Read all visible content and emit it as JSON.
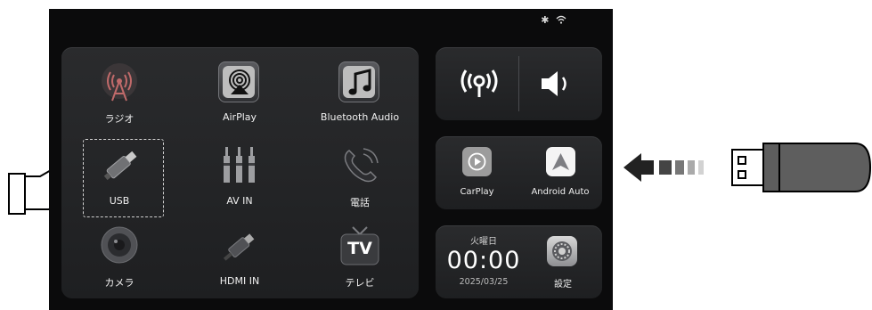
{
  "status": {
    "bluetooth": "bluetooth-icon",
    "wifi": "wifi-icon"
  },
  "apps": [
    {
      "key": "radio",
      "label": "ラジオ",
      "icon": "radio-tower-icon"
    },
    {
      "key": "airplay",
      "label": "AirPlay",
      "icon": "airplay-icon"
    },
    {
      "key": "bt-audio",
      "label": "Bluetooth Audio",
      "icon": "music-note-icon"
    },
    {
      "key": "usb",
      "label": "USB",
      "icon": "usb-icon"
    },
    {
      "key": "av-in",
      "label": "AV IN",
      "icon": "rca-cable-icon"
    },
    {
      "key": "phone",
      "label": "電話",
      "icon": "phone-icon"
    },
    {
      "key": "camera",
      "label": "カメラ",
      "icon": "camera-lens-icon"
    },
    {
      "key": "hdmi-in",
      "label": "HDMI IN",
      "icon": "hdmi-cable-icon"
    },
    {
      "key": "tv",
      "label": "テレビ",
      "icon": "tv-icon",
      "icon_text": "TV"
    }
  ],
  "quick": {
    "radio_icon": "broadcast-icon",
    "volume_icon": "speaker-icon"
  },
  "projection": {
    "carplay_label": "CarPlay",
    "android_label": "Android Auto"
  },
  "clock": {
    "weekday": "火曜日",
    "time": "00:00",
    "date": "2025/03/25",
    "settings_label": "設定"
  },
  "colors": {
    "background": "#0b0b0c",
    "panel": "#242527",
    "text": "#f0f0f0"
  }
}
